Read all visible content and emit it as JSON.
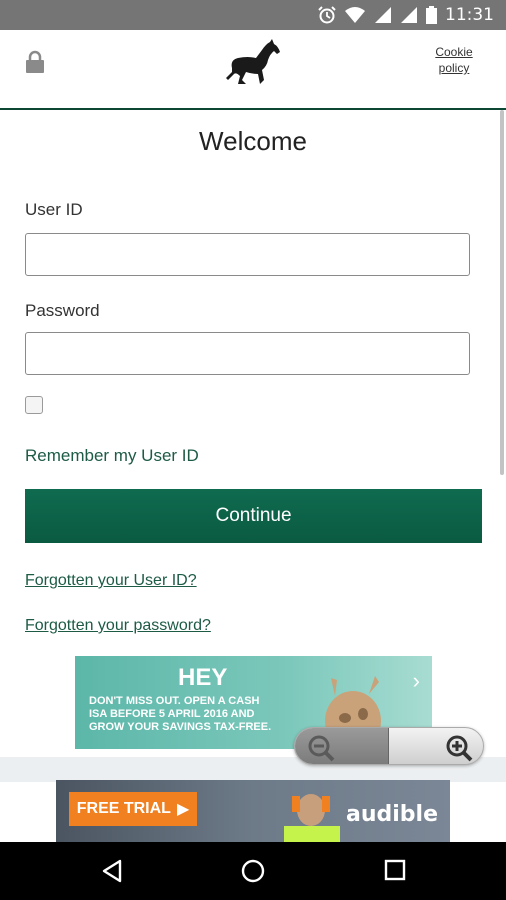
{
  "status_bar": {
    "time": "11:31"
  },
  "header": {
    "cookie_line1": "Cookie",
    "cookie_line2": "policy"
  },
  "form": {
    "title": "Welcome",
    "user_id_label": "User ID",
    "user_id_value": "",
    "password_label": "Password",
    "password_value": "",
    "remember_label": "Remember my User ID",
    "continue_label": "Continue",
    "forgot_user_id": "Forgotten your User ID?",
    "forgot_password": "Forgotten your password?"
  },
  "ad": {
    "headline": "HEY",
    "body": "DON'T MISS OUT. OPEN A CASH ISA BEFORE 5 APRIL 2016 AND GROW YOUR SAVINGS TAX-FREE."
  },
  "bottom_ad": {
    "cta": "FREE TRIAL",
    "brand": "audible"
  },
  "colors": {
    "brand_green": "#0f6b4f",
    "link_green": "#1d5b45",
    "status_bar": "#757575"
  },
  "icons": [
    "alarm-icon",
    "wifi-icon",
    "signal-icon",
    "battery-icon",
    "lock-icon",
    "horse-logo-icon",
    "zoom-out-icon",
    "zoom-in-icon",
    "back-icon",
    "home-icon",
    "recents-icon"
  ]
}
